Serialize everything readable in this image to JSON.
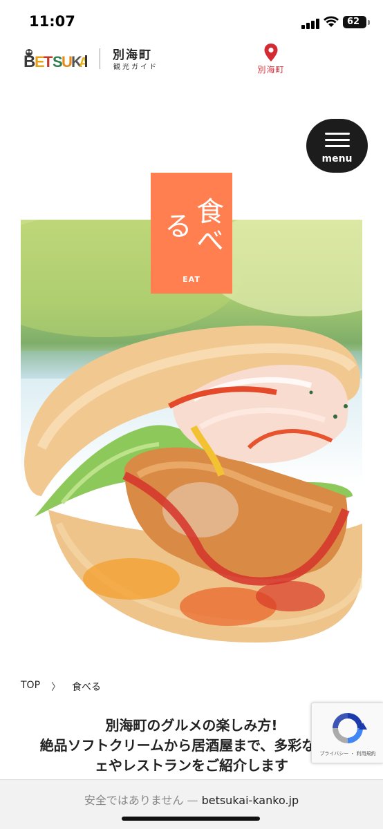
{
  "status_bar": {
    "time": "11:07",
    "battery": "62"
  },
  "header": {
    "logo_text": "BETSUKAI",
    "town_name": "別海町",
    "guide_label": "観光ガイド",
    "map_label": "別海町"
  },
  "menu": {
    "label": "menu"
  },
  "hero": {
    "title": "食べる",
    "subtitle": "EAT"
  },
  "breadcrumb": {
    "home": "TOP",
    "separator": "〉",
    "current": "食べる"
  },
  "intro": {
    "lines": [
      "別海町のグルメの楽しみ方!",
      "絶品ソフトクリームから居酒屋まで、多彩なカフ",
      "ェやレストランをご紹介します"
    ]
  },
  "recaptcha": {
    "text": "プライバシー ・ 利用規約"
  },
  "address_bar": {
    "insecure_label": "安全ではありません —",
    "domain": "betsukai-kanko.jp"
  },
  "colors": {
    "accent": "#ff7f51",
    "map_red": "#d32b34",
    "menu_bg": "#1c1c1c"
  }
}
